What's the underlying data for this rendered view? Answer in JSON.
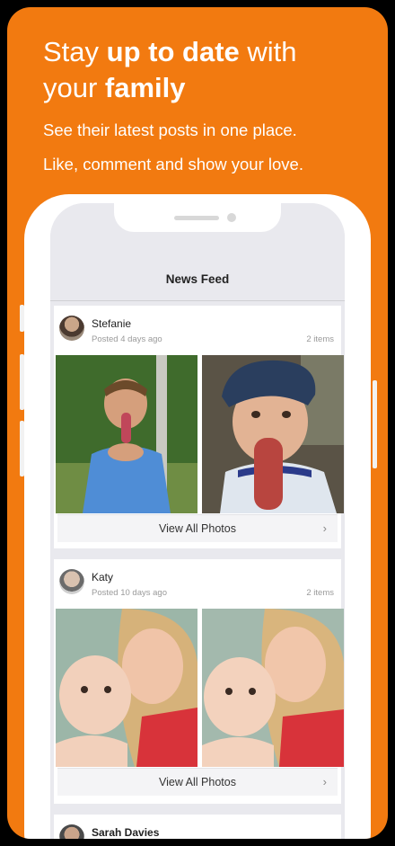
{
  "headline": {
    "line1_a": "Stay ",
    "line1_b": "up to date",
    "line1_c": " with",
    "line2_a": "your ",
    "line2_b": "family"
  },
  "subtitle": {
    "line1": "See their latest posts in one place.",
    "line2": "Like, comment and show your love."
  },
  "nav": {
    "title": "News Feed"
  },
  "posts": [
    {
      "name": "Stefanie",
      "posted": "Posted 4 days ago",
      "items": "2 items",
      "action": "View All Photos",
      "chevron": "›"
    },
    {
      "name": "Katy",
      "posted": "Posted 10 days ago",
      "items": "2 items",
      "action": "View All Photos",
      "chevron": "›"
    },
    {
      "name": "Sarah Davies"
    }
  ],
  "colors": {
    "accent": "#f27a10",
    "background": "#000000",
    "screen": "#e9e9ee"
  }
}
